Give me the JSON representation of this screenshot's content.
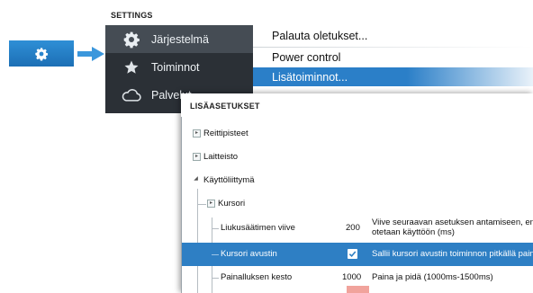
{
  "settings": {
    "title": "SETTINGS",
    "sidebar": [
      {
        "label": "Järjestelmä",
        "icon": "gear-icon",
        "selected": true
      },
      {
        "label": "Toiminnot",
        "icon": "star-icon",
        "selected": false
      },
      {
        "label": "Palvelut",
        "icon": "cloud-icon",
        "selected": false
      }
    ],
    "menu": [
      {
        "label": "Palauta oletukset...",
        "active": false
      },
      {
        "label": "Power control",
        "active": false
      },
      {
        "label": "Lisätoiminnot...",
        "active": true
      }
    ]
  },
  "advanced": {
    "title": "LISÄASETUKSET",
    "rows": {
      "waypoints": {
        "label": "Reittipisteet"
      },
      "hardware": {
        "label": "Laitteisto"
      },
      "ui": {
        "label": "Käyttöliittymä"
      },
      "cursor": {
        "label": "Kursori"
      },
      "slider_delay": {
        "label": "Liukusäätimen viive",
        "value": "200",
        "desc_line1": "Viive seuraavan asetuksen antamiseen, ennen",
        "desc_line2": "otetaan käyttöön (ms)"
      },
      "cursor_assist": {
        "label": "Kursori avustin",
        "checked": true,
        "desc": "Sallii kursori avustin toiminnon pitkällä painal"
      },
      "press_time": {
        "label": "Painalluksen kesto",
        "value": "1000",
        "desc": "Paina ja pidä (1000ms-1500ms)"
      }
    }
  },
  "colors": {
    "accent": "#2e7fc4",
    "sidebar_bg": "#2b3036",
    "badge": "#2a86cf"
  }
}
